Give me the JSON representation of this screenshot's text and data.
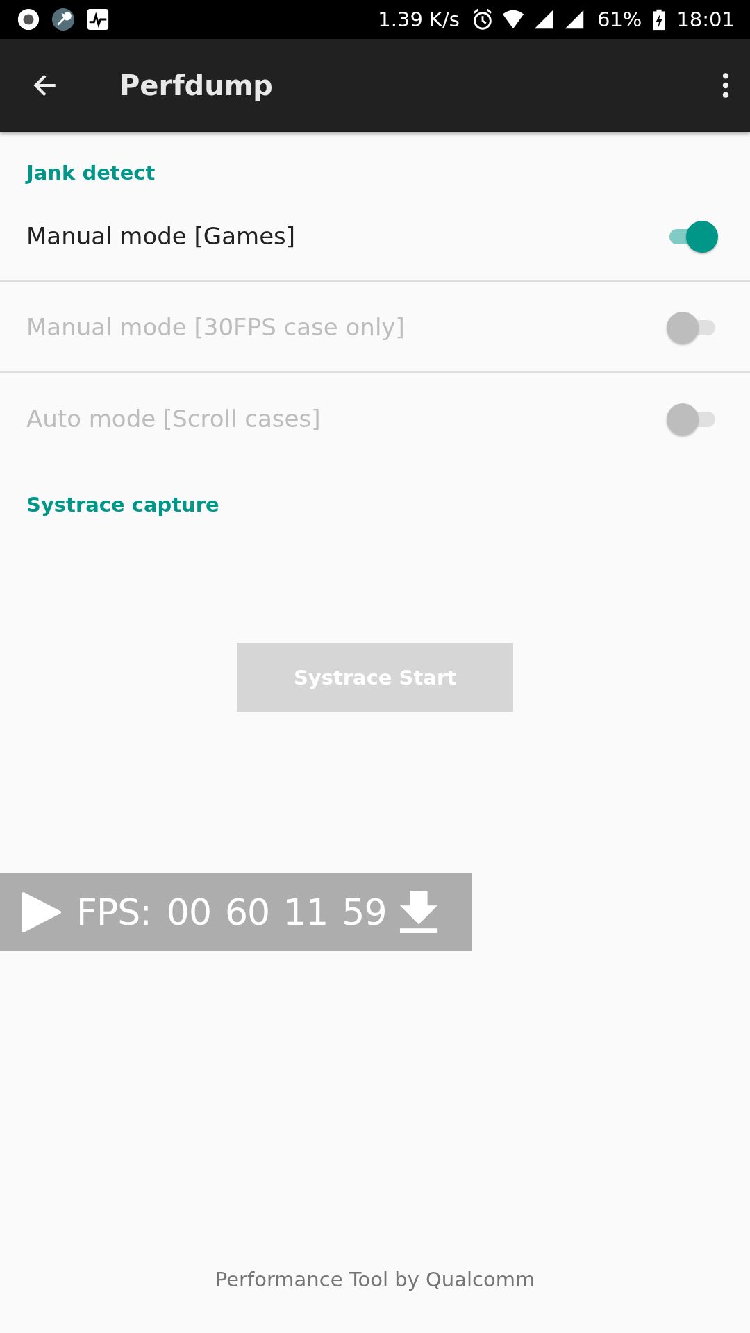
{
  "status_bar": {
    "net_speed": "1.39 K/s",
    "battery": "61%",
    "time": "18:01"
  },
  "app_bar": {
    "title": "Perfdump"
  },
  "sections": [
    {
      "header": "Jank detect",
      "rows": [
        {
          "label": "Manual mode [Games]",
          "on": true,
          "disabled": false
        },
        {
          "label": "Manual mode [30FPS case only]",
          "on": false,
          "disabled": true
        },
        {
          "label": "Auto mode [Scroll cases]",
          "on": false,
          "disabled": true
        }
      ]
    },
    {
      "header": "Systrace capture"
    }
  ],
  "systrace_button": {
    "label": "Systrace Start",
    "disabled": true
  },
  "fps_overlay": {
    "label": "FPS:",
    "values": [
      "00",
      "60",
      "11",
      "59"
    ]
  },
  "footer": "Performance Tool by Qualcomm"
}
